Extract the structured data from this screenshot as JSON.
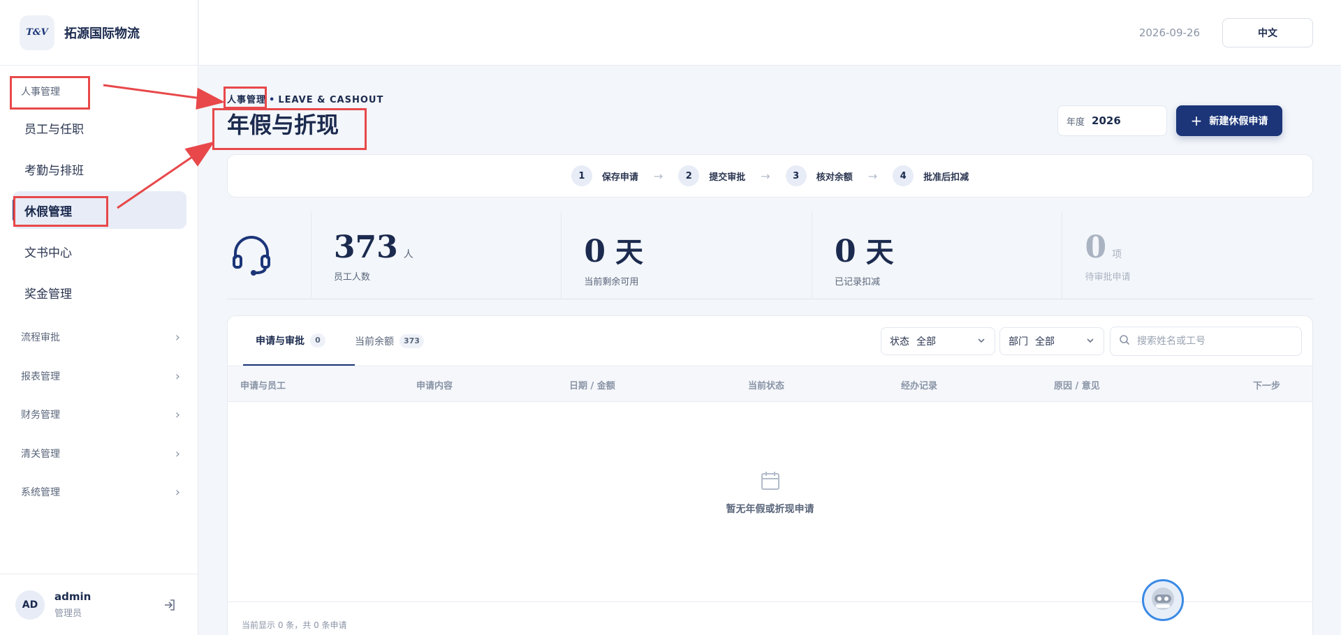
{
  "brand": {
    "logo_text": "T&V",
    "name": "拓源国际物流"
  },
  "topbar": {
    "date": "2026-09-26",
    "language": "中文"
  },
  "sidebar": {
    "group_title": "人事管理",
    "items": [
      {
        "label": "员工与任职"
      },
      {
        "label": "考勤与排班"
      },
      {
        "label": "休假管理",
        "active": true
      },
      {
        "label": "文书中心"
      },
      {
        "label": "奖金管理"
      }
    ],
    "sections": [
      {
        "label": "流程审批"
      },
      {
        "label": "报表管理"
      },
      {
        "label": "财务管理"
      },
      {
        "label": "清关管理"
      },
      {
        "label": "系统管理"
      }
    ],
    "user": {
      "initials": "AD",
      "name": "admin",
      "role": "管理员"
    }
  },
  "header": {
    "breadcrumb_section": "人事管理",
    "breadcrumb_sep": "•",
    "breadcrumb_en": "LEAVE & CASHOUT",
    "title": "年假与折现",
    "year_label": "年度",
    "year_value": "2026",
    "new_button": "新建休假申请"
  },
  "steps": [
    {
      "num": "1",
      "label": "保存申请"
    },
    {
      "num": "2",
      "label": "提交审批"
    },
    {
      "num": "3",
      "label": "核对余额"
    },
    {
      "num": "4",
      "label": "批准后扣减"
    }
  ],
  "step_arrow": "→",
  "stats": [
    {
      "value": "373",
      "unit": "人",
      "label": "员工人数"
    },
    {
      "value": "0",
      "unit": "天",
      "label": "当前剩余可用"
    },
    {
      "value": "0",
      "unit": "天",
      "label": "已记录扣减"
    },
    {
      "value": "0",
      "unit": "项",
      "label": "待审批申请"
    }
  ],
  "tabs": [
    {
      "label": "申请与审批",
      "count": "0",
      "active": true
    },
    {
      "label": "当前余额",
      "count": "373"
    }
  ],
  "filters": {
    "status": {
      "label": "状态",
      "value": "全部"
    },
    "department": {
      "label": "部门",
      "value": "全部"
    },
    "search_placeholder": "搜索姓名或工号"
  },
  "table": {
    "columns": [
      "申请与员工",
      "申请内容",
      "日期 / 金额",
      "当前状态",
      "经办记录",
      "原因 / 意见",
      "下一步"
    ],
    "empty_text": "暂无年假或折现申请",
    "footer": "当前显示 0 条，共 0 条申请"
  },
  "colors": {
    "primary": "#1b3578",
    "annotation": "#e8484a",
    "background": "#f3f6fa"
  }
}
